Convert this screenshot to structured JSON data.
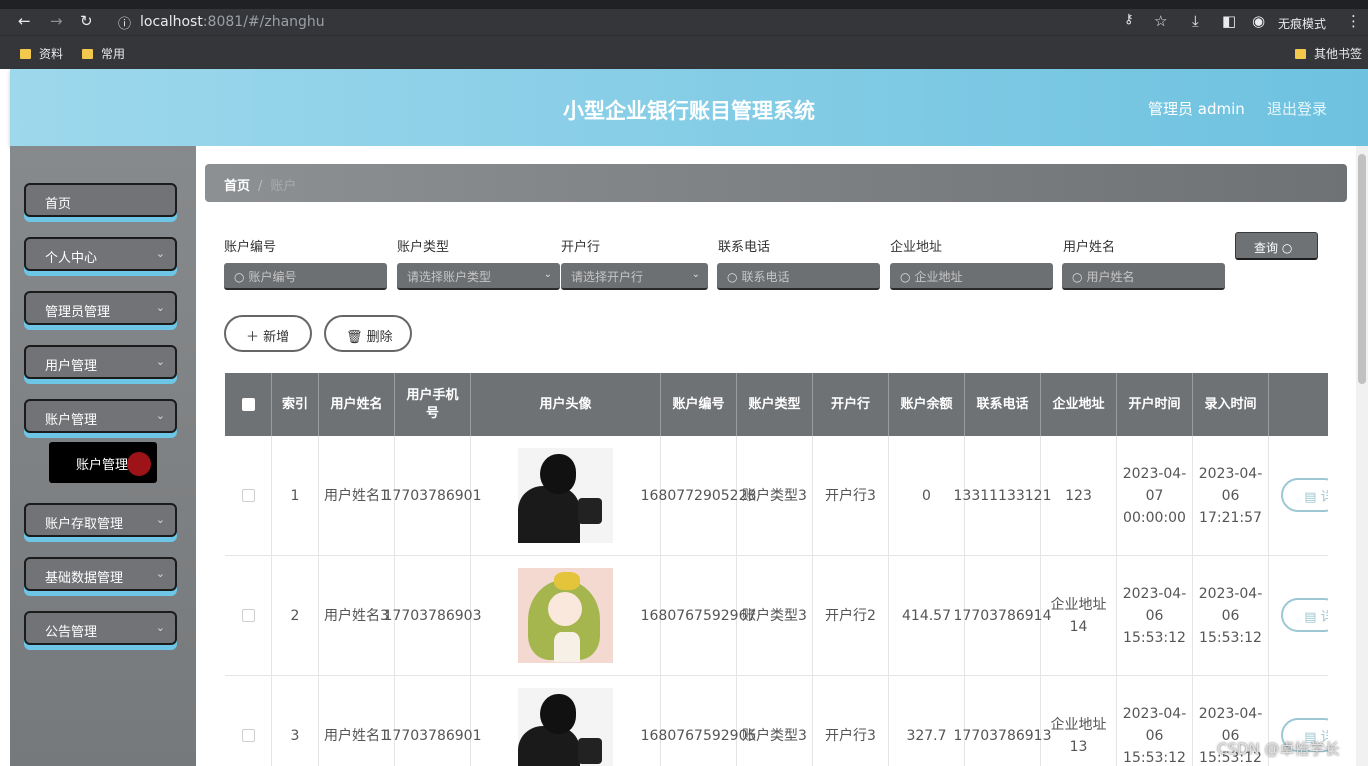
{
  "browser": {
    "url_host": "localhost",
    "url_path": ":8081/#/zhanghu",
    "incognito_label": "无痕模式",
    "bookmarks": [
      "资料",
      "常用"
    ],
    "other_bookmarks": "其他书签"
  },
  "header": {
    "title": "小型企业银行账目管理系统",
    "admin": "管理员 admin",
    "logout": "退出登录"
  },
  "sidebar": {
    "items": [
      {
        "label": "首页"
      },
      {
        "label": "个人中心"
      },
      {
        "label": "管理员管理"
      },
      {
        "label": "用户管理"
      },
      {
        "label": "账户管理"
      },
      {
        "label": "账户存取管理"
      },
      {
        "label": "基础数据管理"
      },
      {
        "label": "公告管理"
      }
    ],
    "active_sub": "账户管理"
  },
  "breadcrumb": {
    "home": "首页",
    "sep": "/",
    "current": "账户"
  },
  "filters": [
    {
      "label": "账户编号",
      "placeholder": "账户编号"
    },
    {
      "label": "账户类型",
      "placeholder": "请选择账户类型"
    },
    {
      "label": "开户行",
      "placeholder": "请选择开户行"
    },
    {
      "label": "联系电话",
      "placeholder": "联系电话"
    },
    {
      "label": "企业地址",
      "placeholder": "企业地址"
    },
    {
      "label": "用户姓名",
      "placeholder": "用户姓名"
    }
  ],
  "buttons": {
    "search": "查询",
    "add": "新增",
    "delete": "删除",
    "detail": "详"
  },
  "table": {
    "headers": [
      "索引",
      "用户姓名",
      "用户手机号",
      "用户头像",
      "账户编号",
      "账户类型",
      "开户行",
      "账户余额",
      "联系电话",
      "企业地址",
      "开户时间",
      "录入时间"
    ],
    "rows": [
      {
        "idx": "1",
        "name": "用户姓名1",
        "phone": "17703786901",
        "avatar": "man",
        "acct": "1680772905228",
        "type": "账户类型3",
        "bank": "开户行3",
        "balance": "0",
        "tel": "13311133121",
        "addr": "123",
        "open": "2023-04-07 00:00:00",
        "entry": "2023-04-06 17:21:57"
      },
      {
        "idx": "2",
        "name": "用户姓名3",
        "phone": "17703786903",
        "avatar": "girl",
        "acct": "1680767592967",
        "type": "账户类型3",
        "bank": "开户行2",
        "balance": "414.57",
        "tel": "17703786914",
        "addr": "企业地址14",
        "open": "2023-04-06 15:53:12",
        "entry": "2023-04-06 15:53:12"
      },
      {
        "idx": "3",
        "name": "用户姓名1",
        "phone": "17703786901",
        "avatar": "man",
        "acct": "1680767592905",
        "type": "账户类型3",
        "bank": "开户行3",
        "balance": "327.7",
        "tel": "17703786913",
        "addr": "企业地址13",
        "open": "2023-04-06 15:53:12",
        "entry": "2023-04-06 15:53:12"
      }
    ]
  },
  "watermark": "CSDN @卓怡学长"
}
